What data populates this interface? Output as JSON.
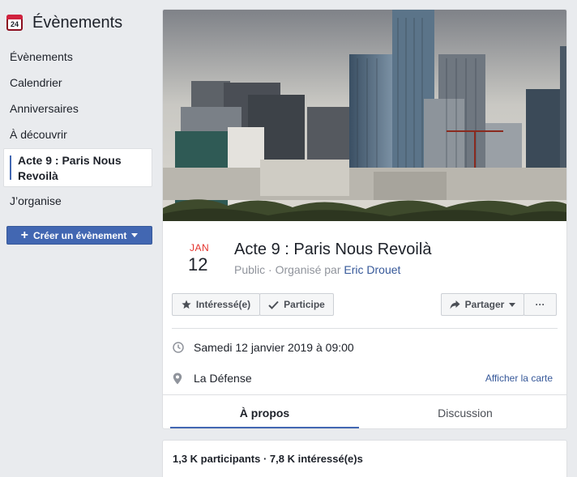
{
  "sidebar": {
    "calendar_icon_day": "24",
    "title": "Évènements",
    "items": [
      {
        "label": "Évènements"
      },
      {
        "label": "Calendrier"
      },
      {
        "label": "Anniversaires"
      },
      {
        "label": "À découvrir"
      },
      {
        "label": "Acte 9 : Paris Nous Revoilà"
      },
      {
        "label": "J’organise"
      }
    ],
    "create_button": "Créer un évènement"
  },
  "event": {
    "month": "JAN",
    "day": "12",
    "title": "Acte 9 : Paris Nous Revoilà",
    "privacy": "Public · Organisé par ",
    "organizer": "Eric Drouet",
    "buttons": {
      "interested": "Intéressé(e)",
      "going": "Participe",
      "share": "Partager",
      "more": "···"
    },
    "datetime": "Samedi 12 janvier 2019 à 09:00",
    "location": "La Défense",
    "map_link": "Afficher la carte",
    "tabs": [
      {
        "label": "À propos",
        "active": true
      },
      {
        "label": "Discussion",
        "active": false
      }
    ],
    "stats": "1,3 K participants · 7,8 K intéressé(e)s"
  },
  "colors": {
    "brand": "#4267b2",
    "link": "#365899",
    "month_red": "#e4322c",
    "background": "#e9ebee"
  },
  "icons": [
    "calendar-icon",
    "star-icon",
    "check-icon",
    "share-arrow-icon",
    "clock-icon",
    "location-pin-icon"
  ]
}
